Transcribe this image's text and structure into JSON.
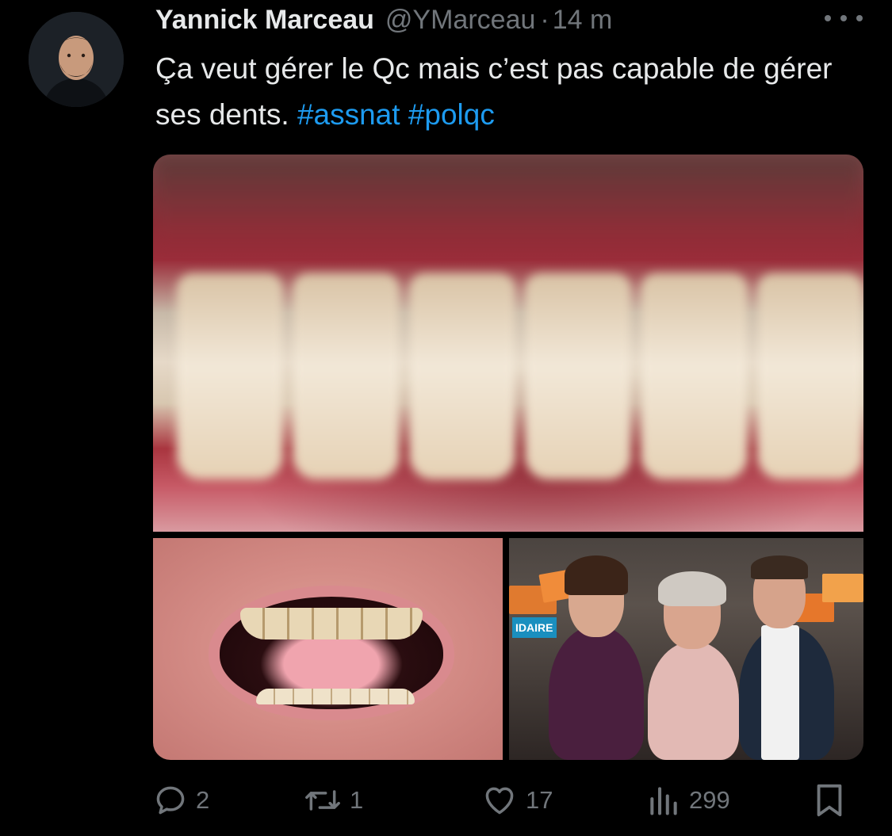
{
  "tweet": {
    "author_name": "Yannick Marceau",
    "handle": "@YMarceau",
    "separator": "·",
    "timestamp": "14 m",
    "text_main": "Ça veut gérer le Qc mais c’est pas capable de gérer ses dents. ",
    "hashtags": [
      "#assnat",
      "#polqc"
    ]
  },
  "media": {
    "items": [
      {
        "icon": "teeth-closeup-image"
      },
      {
        "icon": "open-mouth-closeup-image"
      },
      {
        "icon": "group-photo-image",
        "visible_text": "IDAIRE"
      }
    ]
  },
  "actions": {
    "reply": {
      "icon": "reply-icon",
      "count": "2"
    },
    "retweet": {
      "icon": "retweet-icon",
      "count": "1"
    },
    "like": {
      "icon": "heart-icon",
      "count": "17"
    },
    "views": {
      "icon": "views-icon",
      "count": "299"
    },
    "bookmark": {
      "icon": "bookmark-icon"
    }
  },
  "colors": {
    "background": "#000000",
    "text": "#e7e9ea",
    "muted": "#71767b",
    "link": "#1d9bf0"
  }
}
